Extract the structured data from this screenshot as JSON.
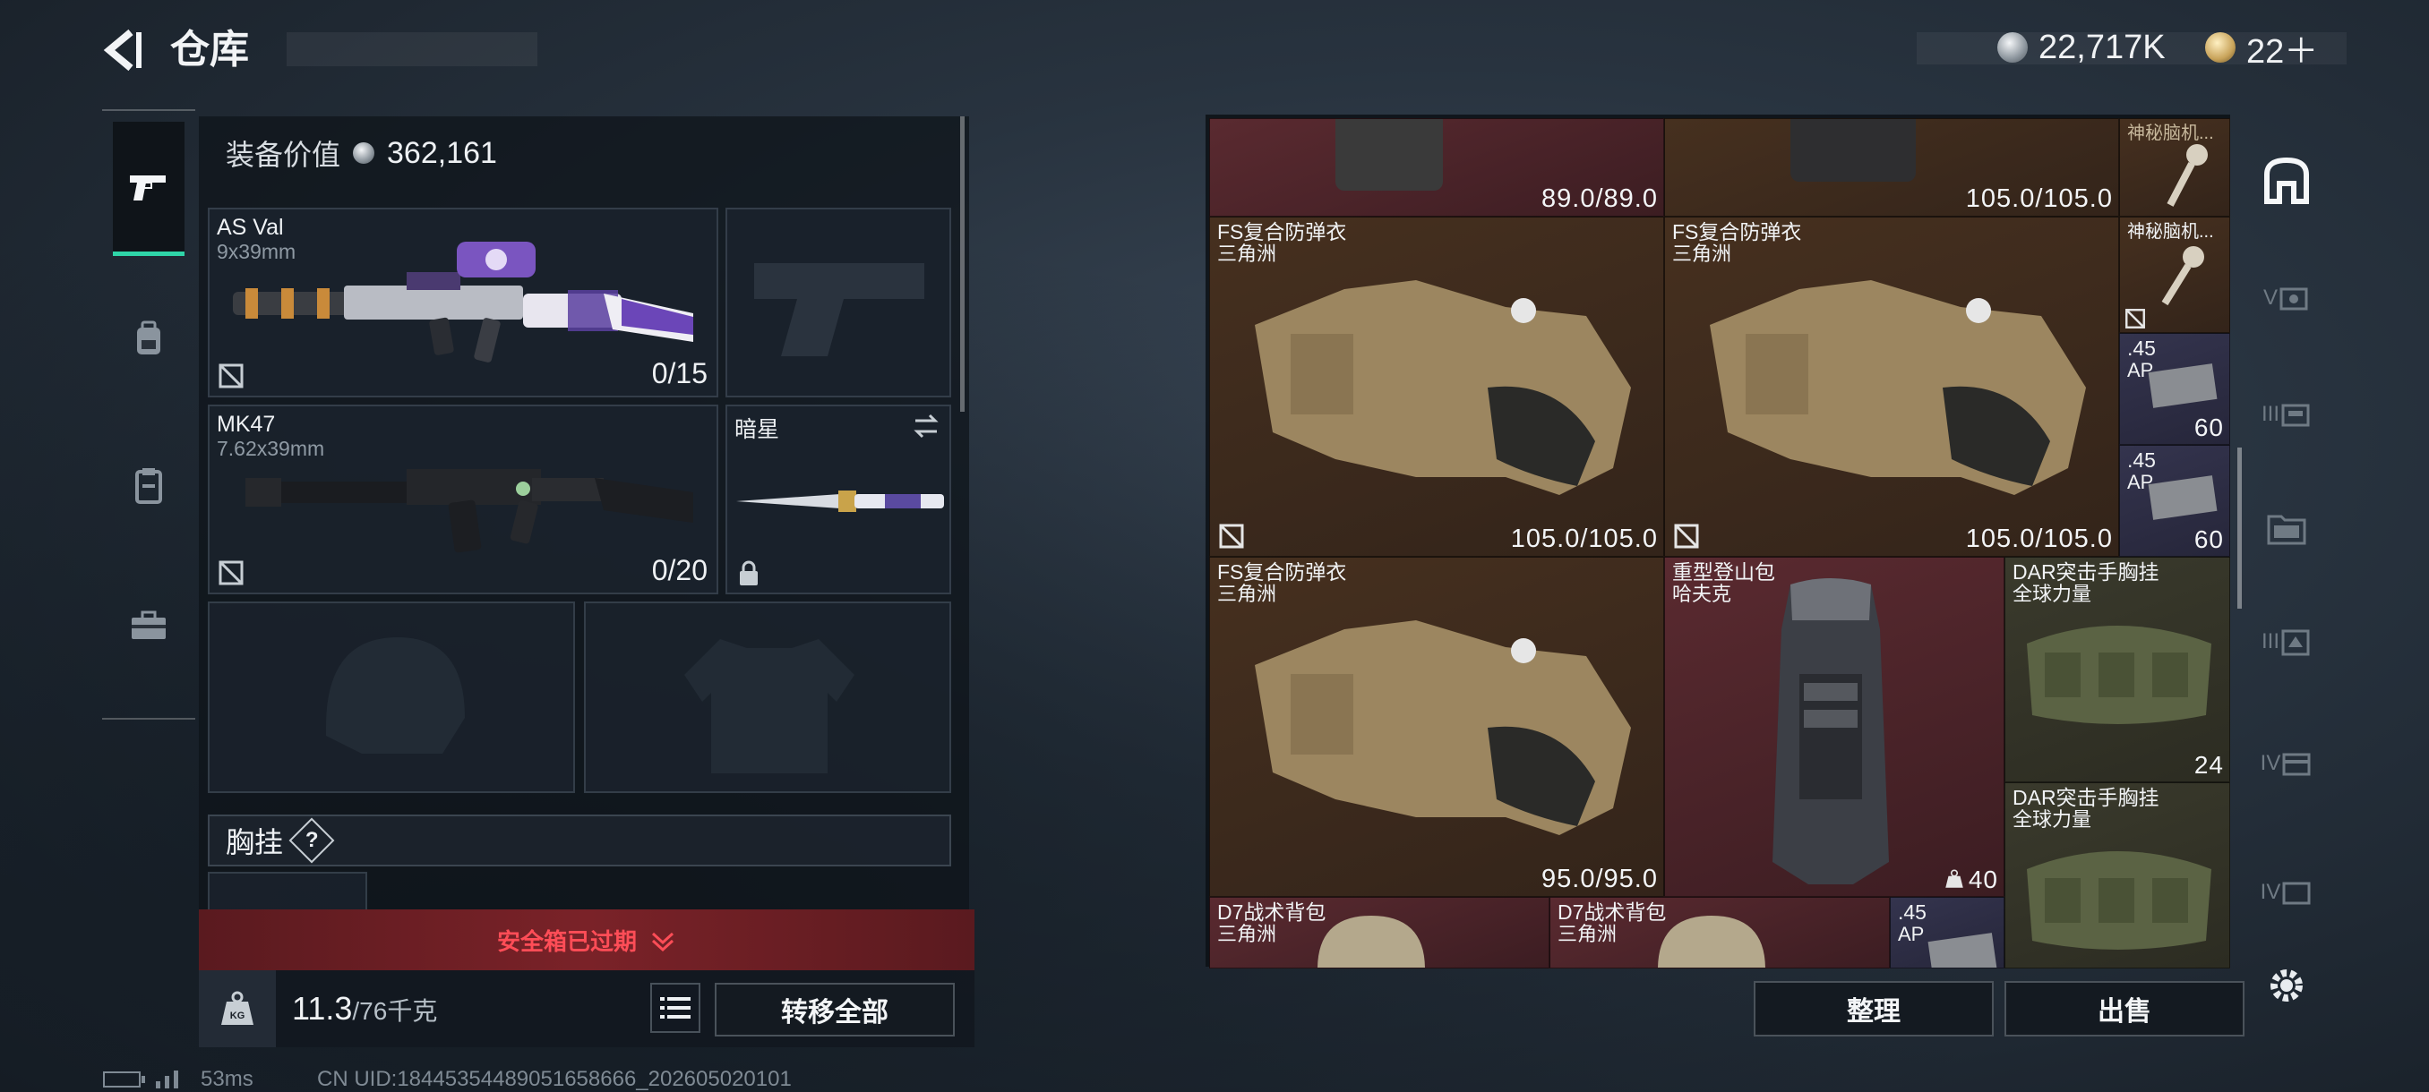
{
  "header": {
    "title": "仓库",
    "currency_silver": "22,717K",
    "currency_gold": "22＋"
  },
  "left_nav": {
    "tabs": [
      {
        "icon": "pistol-icon",
        "active": true
      },
      {
        "icon": "backpack-icon",
        "active": false
      },
      {
        "icon": "clipboard-icon",
        "active": false
      },
      {
        "icon": "toolbox-icon",
        "active": false
      }
    ]
  },
  "equipment": {
    "value_label": "装备价值",
    "value": "362,161",
    "primary_weapon": {
      "name": "AS Val",
      "caliber": "9x39mm",
      "ammo": "0/15"
    },
    "secondary_weapon": {
      "name": "MK47",
      "caliber": "7.62x39mm",
      "ammo": "0/20"
    },
    "melee": {
      "name": "暗星"
    },
    "chest_rig_label": "胸挂",
    "help_symbol": "?",
    "safebox_status": "安全箱已过期",
    "weight_current": "11.3",
    "weight_capacity": "/76千克",
    "kg_label": "KG",
    "transfer_all": "转移全部"
  },
  "storage": {
    "top_values": [
      "89.0/89.0",
      "105.0/105.0"
    ],
    "items": [
      {
        "name": "神秘脑机...",
        "sub": ""
      },
      {
        "name": "FS复合防弹衣",
        "sub": "三角洲",
        "value": "105.0/105.0"
      },
      {
        "name": "FS复合防弹衣",
        "sub": "三角洲",
        "value": "105.0/105.0"
      },
      {
        "name": "神秘脑机...",
        "sub": ""
      },
      {
        "name": ".45",
        "sub": "AP",
        "value": "60"
      },
      {
        "name": ".45",
        "sub": "AP",
        "value": "60"
      },
      {
        "name": "FS复合防弹衣",
        "sub": "三角洲",
        "value": "95.0/95.0"
      },
      {
        "name": "重型登山包",
        "sub": "哈夫克",
        "value": "40"
      },
      {
        "name": "DAR突击手胸挂",
        "sub": "全球力量",
        "value": "24"
      },
      {
        "name": "DAR突击手胸挂",
        "sub": "全球力量"
      },
      {
        "name": "D7战术背包",
        "sub": "三角洲"
      },
      {
        "name": "D7战术背包",
        "sub": "三角洲"
      },
      {
        "name": ".45",
        "sub": "AP"
      }
    ],
    "sort_label": "整理",
    "sell_label": "出售"
  },
  "right_rail": [
    "V",
    "III",
    "III",
    "IV",
    "IV"
  ],
  "footer": {
    "ping": "53ms",
    "uid": "CN UID:18445354489051658666_202605020101"
  },
  "colors": {
    "accent": "#2fd5a8",
    "danger": "#ff4d57",
    "cell_brown": "#46301f",
    "cell_red": "#5a2a30"
  }
}
